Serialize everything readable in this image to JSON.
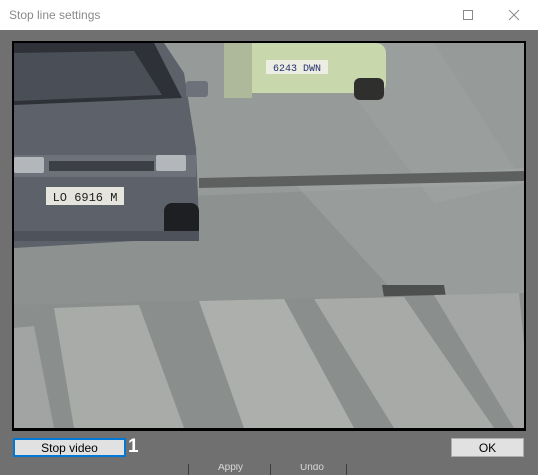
{
  "window": {
    "title": "Stop line settings",
    "controls": {
      "maximize_icon": "maximize-icon",
      "close_icon": "close-icon"
    }
  },
  "video": {
    "plates": [
      "6243 DWN",
      "LO 6916 M"
    ]
  },
  "buttons": {
    "stop_video": "Stop video",
    "ok": "OK"
  },
  "callout_number": "1",
  "underlying_window": {
    "partial_labels": [
      "Apply",
      "Undo"
    ]
  },
  "colors": {
    "title_text": "#8a8a8a",
    "client_background": "#707070",
    "focus_border": "#0078d7",
    "button_face": "#e1e1e1"
  }
}
